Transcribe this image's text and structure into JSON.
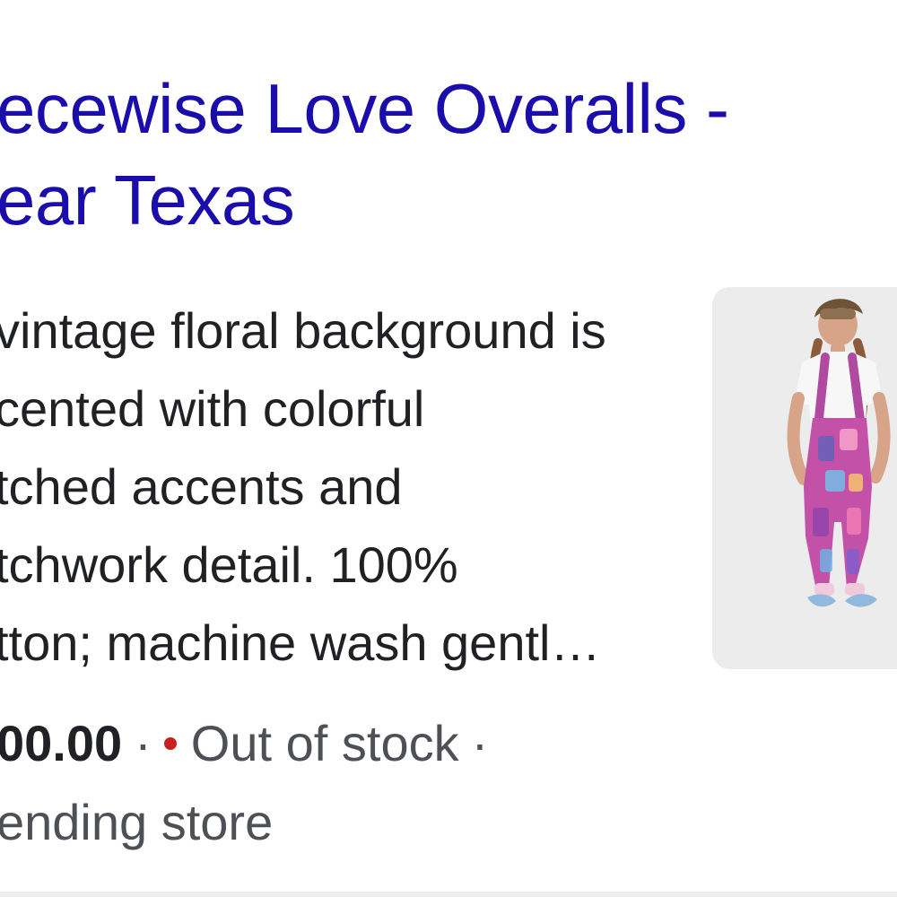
{
  "result": {
    "title_lines": [
      "ecewise Love Overalls -",
      "ear Texas"
    ],
    "snippet_lines": [
      "vintage floral background is",
      "cented with colorful",
      "tched accents and",
      "tchwork detail. 100%",
      "tton; machine wash gentl…"
    ],
    "price": "00.00",
    "separator": "·",
    "stock_status": "Out of stock",
    "store_line": "ending store",
    "colors": {
      "title": "#1a0dab",
      "text": "#202124",
      "muted": "#4d5156",
      "stock_dot": "#c5221f"
    },
    "thumbnail_icon": "product-photo-overalls"
  }
}
